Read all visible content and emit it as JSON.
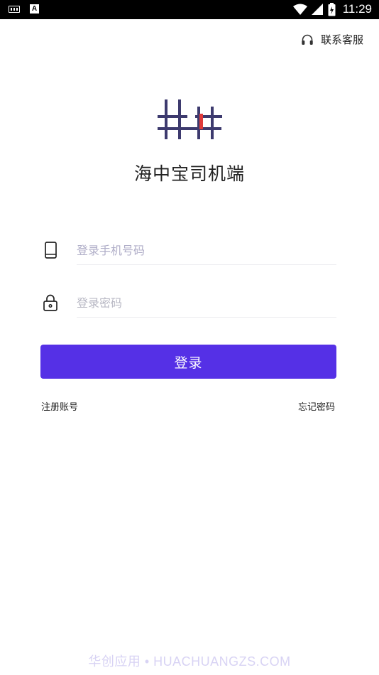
{
  "status_bar": {
    "time": "11:29"
  },
  "header": {
    "service_label": "联系客服"
  },
  "brand": {
    "app_name": "海中宝司机端"
  },
  "form": {
    "phone": {
      "placeholder": "登录手机号码",
      "value": ""
    },
    "password": {
      "placeholder": "登录密码",
      "value": ""
    },
    "login_label": "登录"
  },
  "links": {
    "register": "注册账号",
    "forgot": "忘记密码"
  },
  "watermark": "华创应用 • HUACHUANGZS.COM",
  "colors": {
    "accent": "#5530e6",
    "logo_dark": "#3d3a6e",
    "logo_red": "#e03a3a"
  }
}
